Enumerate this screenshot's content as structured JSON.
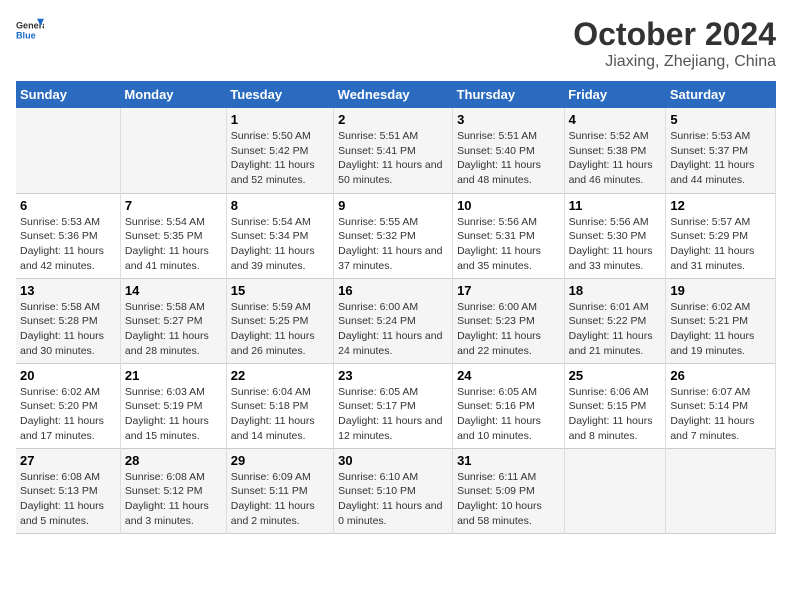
{
  "header": {
    "logo_general": "General",
    "logo_blue": "Blue",
    "title": "October 2024",
    "subtitle": "Jiaxing, Zhejiang, China"
  },
  "calendar": {
    "days_of_week": [
      "Sunday",
      "Monday",
      "Tuesday",
      "Wednesday",
      "Thursday",
      "Friday",
      "Saturday"
    ],
    "rows": [
      [
        {
          "day": "",
          "sunrise": "",
          "sunset": "",
          "daylight": ""
        },
        {
          "day": "",
          "sunrise": "",
          "sunset": "",
          "daylight": ""
        },
        {
          "day": "1",
          "sunrise": "Sunrise: 5:50 AM",
          "sunset": "Sunset: 5:42 PM",
          "daylight": "Daylight: 11 hours and 52 minutes."
        },
        {
          "day": "2",
          "sunrise": "Sunrise: 5:51 AM",
          "sunset": "Sunset: 5:41 PM",
          "daylight": "Daylight: 11 hours and 50 minutes."
        },
        {
          "day": "3",
          "sunrise": "Sunrise: 5:51 AM",
          "sunset": "Sunset: 5:40 PM",
          "daylight": "Daylight: 11 hours and 48 minutes."
        },
        {
          "day": "4",
          "sunrise": "Sunrise: 5:52 AM",
          "sunset": "Sunset: 5:38 PM",
          "daylight": "Daylight: 11 hours and 46 minutes."
        },
        {
          "day": "5",
          "sunrise": "Sunrise: 5:53 AM",
          "sunset": "Sunset: 5:37 PM",
          "daylight": "Daylight: 11 hours and 44 minutes."
        }
      ],
      [
        {
          "day": "6",
          "sunrise": "Sunrise: 5:53 AM",
          "sunset": "Sunset: 5:36 PM",
          "daylight": "Daylight: 11 hours and 42 minutes."
        },
        {
          "day": "7",
          "sunrise": "Sunrise: 5:54 AM",
          "sunset": "Sunset: 5:35 PM",
          "daylight": "Daylight: 11 hours and 41 minutes."
        },
        {
          "day": "8",
          "sunrise": "Sunrise: 5:54 AM",
          "sunset": "Sunset: 5:34 PM",
          "daylight": "Daylight: 11 hours and 39 minutes."
        },
        {
          "day": "9",
          "sunrise": "Sunrise: 5:55 AM",
          "sunset": "Sunset: 5:32 PM",
          "daylight": "Daylight: 11 hours and 37 minutes."
        },
        {
          "day": "10",
          "sunrise": "Sunrise: 5:56 AM",
          "sunset": "Sunset: 5:31 PM",
          "daylight": "Daylight: 11 hours and 35 minutes."
        },
        {
          "day": "11",
          "sunrise": "Sunrise: 5:56 AM",
          "sunset": "Sunset: 5:30 PM",
          "daylight": "Daylight: 11 hours and 33 minutes."
        },
        {
          "day": "12",
          "sunrise": "Sunrise: 5:57 AM",
          "sunset": "Sunset: 5:29 PM",
          "daylight": "Daylight: 11 hours and 31 minutes."
        }
      ],
      [
        {
          "day": "13",
          "sunrise": "Sunrise: 5:58 AM",
          "sunset": "Sunset: 5:28 PM",
          "daylight": "Daylight: 11 hours and 30 minutes."
        },
        {
          "day": "14",
          "sunrise": "Sunrise: 5:58 AM",
          "sunset": "Sunset: 5:27 PM",
          "daylight": "Daylight: 11 hours and 28 minutes."
        },
        {
          "day": "15",
          "sunrise": "Sunrise: 5:59 AM",
          "sunset": "Sunset: 5:25 PM",
          "daylight": "Daylight: 11 hours and 26 minutes."
        },
        {
          "day": "16",
          "sunrise": "Sunrise: 6:00 AM",
          "sunset": "Sunset: 5:24 PM",
          "daylight": "Daylight: 11 hours and 24 minutes."
        },
        {
          "day": "17",
          "sunrise": "Sunrise: 6:00 AM",
          "sunset": "Sunset: 5:23 PM",
          "daylight": "Daylight: 11 hours and 22 minutes."
        },
        {
          "day": "18",
          "sunrise": "Sunrise: 6:01 AM",
          "sunset": "Sunset: 5:22 PM",
          "daylight": "Daylight: 11 hours and 21 minutes."
        },
        {
          "day": "19",
          "sunrise": "Sunrise: 6:02 AM",
          "sunset": "Sunset: 5:21 PM",
          "daylight": "Daylight: 11 hours and 19 minutes."
        }
      ],
      [
        {
          "day": "20",
          "sunrise": "Sunrise: 6:02 AM",
          "sunset": "Sunset: 5:20 PM",
          "daylight": "Daylight: 11 hours and 17 minutes."
        },
        {
          "day": "21",
          "sunrise": "Sunrise: 6:03 AM",
          "sunset": "Sunset: 5:19 PM",
          "daylight": "Daylight: 11 hours and 15 minutes."
        },
        {
          "day": "22",
          "sunrise": "Sunrise: 6:04 AM",
          "sunset": "Sunset: 5:18 PM",
          "daylight": "Daylight: 11 hours and 14 minutes."
        },
        {
          "day": "23",
          "sunrise": "Sunrise: 6:05 AM",
          "sunset": "Sunset: 5:17 PM",
          "daylight": "Daylight: 11 hours and 12 minutes."
        },
        {
          "day": "24",
          "sunrise": "Sunrise: 6:05 AM",
          "sunset": "Sunset: 5:16 PM",
          "daylight": "Daylight: 11 hours and 10 minutes."
        },
        {
          "day": "25",
          "sunrise": "Sunrise: 6:06 AM",
          "sunset": "Sunset: 5:15 PM",
          "daylight": "Daylight: 11 hours and 8 minutes."
        },
        {
          "day": "26",
          "sunrise": "Sunrise: 6:07 AM",
          "sunset": "Sunset: 5:14 PM",
          "daylight": "Daylight: 11 hours and 7 minutes."
        }
      ],
      [
        {
          "day": "27",
          "sunrise": "Sunrise: 6:08 AM",
          "sunset": "Sunset: 5:13 PM",
          "daylight": "Daylight: 11 hours and 5 minutes."
        },
        {
          "day": "28",
          "sunrise": "Sunrise: 6:08 AM",
          "sunset": "Sunset: 5:12 PM",
          "daylight": "Daylight: 11 hours and 3 minutes."
        },
        {
          "day": "29",
          "sunrise": "Sunrise: 6:09 AM",
          "sunset": "Sunset: 5:11 PM",
          "daylight": "Daylight: 11 hours and 2 minutes."
        },
        {
          "day": "30",
          "sunrise": "Sunrise: 6:10 AM",
          "sunset": "Sunset: 5:10 PM",
          "daylight": "Daylight: 11 hours and 0 minutes."
        },
        {
          "day": "31",
          "sunrise": "Sunrise: 6:11 AM",
          "sunset": "Sunset: 5:09 PM",
          "daylight": "Daylight: 10 hours and 58 minutes."
        },
        {
          "day": "",
          "sunrise": "",
          "sunset": "",
          "daylight": ""
        },
        {
          "day": "",
          "sunrise": "",
          "sunset": "",
          "daylight": ""
        }
      ]
    ]
  }
}
